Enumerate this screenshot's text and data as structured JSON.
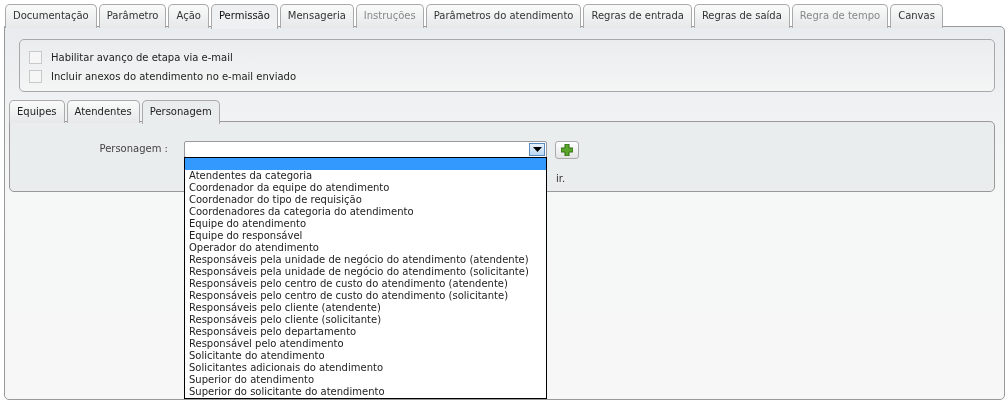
{
  "tabs": [
    {
      "label": "Documentação",
      "selected": false,
      "disabled": false
    },
    {
      "label": "Parâmetro",
      "selected": false,
      "disabled": false
    },
    {
      "label": "Ação",
      "selected": false,
      "disabled": false
    },
    {
      "label": "Permissão",
      "selected": true,
      "disabled": false
    },
    {
      "label": "Mensageria",
      "selected": false,
      "disabled": false
    },
    {
      "label": "Instruções",
      "selected": false,
      "disabled": true
    },
    {
      "label": "Parâmetros do atendimento",
      "selected": false,
      "disabled": false
    },
    {
      "label": "Regras de entrada",
      "selected": false,
      "disabled": false
    },
    {
      "label": "Regras de saída",
      "selected": false,
      "disabled": false
    },
    {
      "label": "Regra de tempo",
      "selected": false,
      "disabled": true
    },
    {
      "label": "Canvas",
      "selected": false,
      "disabled": false
    }
  ],
  "options": [
    {
      "label": "Habilitar avanço de etapa via e-mail",
      "checked": false
    },
    {
      "label": "Incluir anexos do atendimento no e-mail enviado",
      "checked": false
    }
  ],
  "subtabs": [
    {
      "label": "Equipes",
      "selected": false
    },
    {
      "label": "Atendentes",
      "selected": false
    },
    {
      "label": "Personagem",
      "selected": true
    }
  ],
  "personagem": {
    "label": "Personagem :",
    "note": "ir.",
    "dropdown": {
      "open": true,
      "blank_highlighted": true,
      "options": [
        "Atendentes da categoria",
        "Coordenador da equipe do atendimento",
        "Coordenador do tipo de requisição",
        "Coordenadores da categoria do atendimento",
        "Equipe do atendimento",
        "Equipe do responsável",
        "Operador do atendimento",
        "Responsáveis pela unidade de negócio do atendimento (atendente)",
        "Responsáveis pela unidade de negócio do atendimento (solicitante)",
        "Responsáveis pelo centro de custo do atendimento (atendente)",
        "Responsáveis pelo centro de custo do atendimento (solicitante)",
        "Responsáveis pelo cliente (atendente)",
        "Responsáveis pelo cliente (solicitante)",
        "Responsáveis pelo departamento",
        "Responsável pelo atendimento",
        "Solicitante do atendimento",
        "Solicitantes adicionais do atendimento",
        "Superior do atendimento",
        "Superior do solicitante do atendimento"
      ]
    }
  }
}
